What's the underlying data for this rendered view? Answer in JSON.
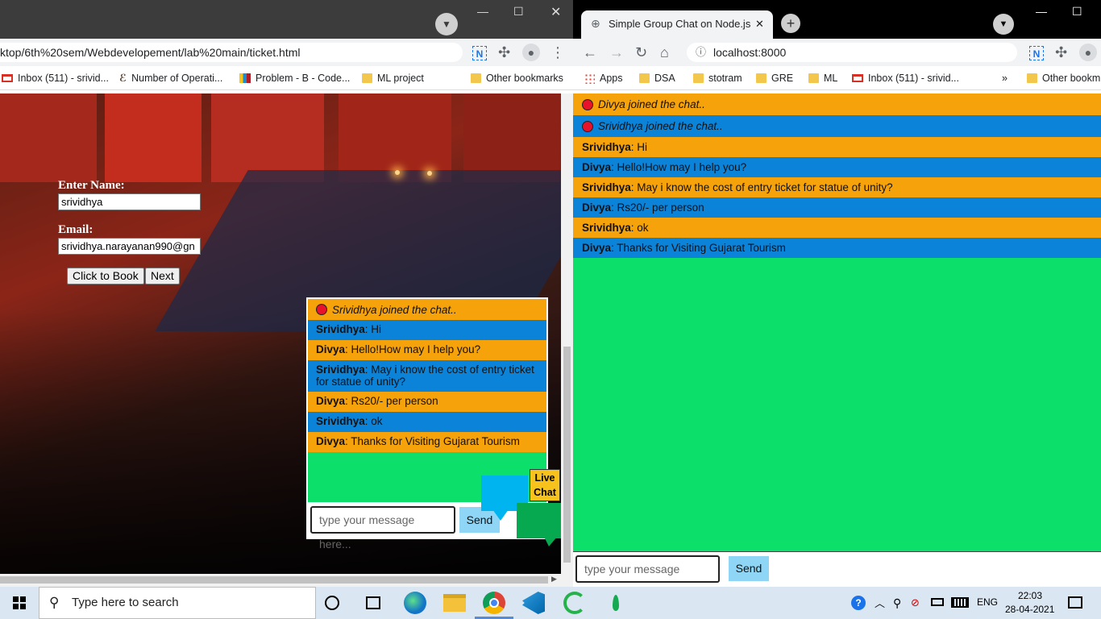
{
  "left_window": {
    "url": "ktop/6th%20sem/Webdevelopement/lab%20main/ticket.html",
    "bookmarks": [
      "Inbox (511) - srivid...",
      "Number of Operati...",
      "Problem - B - Code...",
      "ML project",
      "Other bookmarks"
    ],
    "form": {
      "name_label": "Enter Name:",
      "name_value": "srividhya",
      "email_label": "Email:",
      "email_value": "srividhya.narayanan990@gn",
      "book_button": "Click to Book",
      "next_button": "Next"
    },
    "chat": {
      "messages": [
        {
          "type": "join",
          "text": "Srividhya joined the chat.."
        },
        {
          "sender": "Srividhya",
          "text": ": Hi"
        },
        {
          "sender": "Divya",
          "text": ": Hello!How may I help you?"
        },
        {
          "sender": "Srividhya",
          "text": ": May i know the cost of entry ticket for statue of unity?"
        },
        {
          "sender": "Divya",
          "text": ": Rs20/- per person"
        },
        {
          "sender": "Srividhya",
          "text": ": ok"
        },
        {
          "sender": "Divya",
          "text": ": Thanks for Visiting Gujarat Tourism"
        }
      ],
      "input_placeholder": "type your message here...",
      "send_label": "Send",
      "live_chat_label": "Live Chat"
    }
  },
  "right_window": {
    "tab_title": "Simple Group Chat on Node.js",
    "url": "localhost:8000",
    "bookmarks": [
      "Apps",
      "DSA",
      "stotram",
      "GRE",
      "ML",
      "Inbox (511) - srivid...",
      "Other bookm"
    ],
    "chat": {
      "messages": [
        {
          "type": "join",
          "text": "Divya joined the chat.."
        },
        {
          "type": "join",
          "text": "Srividhya joined the chat.."
        },
        {
          "sender": "Srividhya",
          "text": ": Hi"
        },
        {
          "sender": "Divya",
          "text": ": Hello!How may I help you?"
        },
        {
          "sender": "Srividhya",
          "text": ": May i know the cost of entry ticket for statue of unity?"
        },
        {
          "sender": "Divya",
          "text": ": Rs20/- per person"
        },
        {
          "sender": "Srividhya",
          "text": ": ok"
        },
        {
          "sender": "Divya",
          "text": ": Thanks for Visiting Gujarat Tourism"
        }
      ],
      "input_placeholder": "type your message here...",
      "send_label": "Send"
    }
  },
  "taskbar": {
    "search_placeholder": "Type here to search",
    "language": "ENG",
    "time": "22:03",
    "date": "28-04-2021"
  },
  "colors": {
    "msg_orange": "#f6a20a",
    "msg_blue": "#0b83d9",
    "chat_bg": "#0de06a",
    "send_btn": "#8fd6f6"
  }
}
